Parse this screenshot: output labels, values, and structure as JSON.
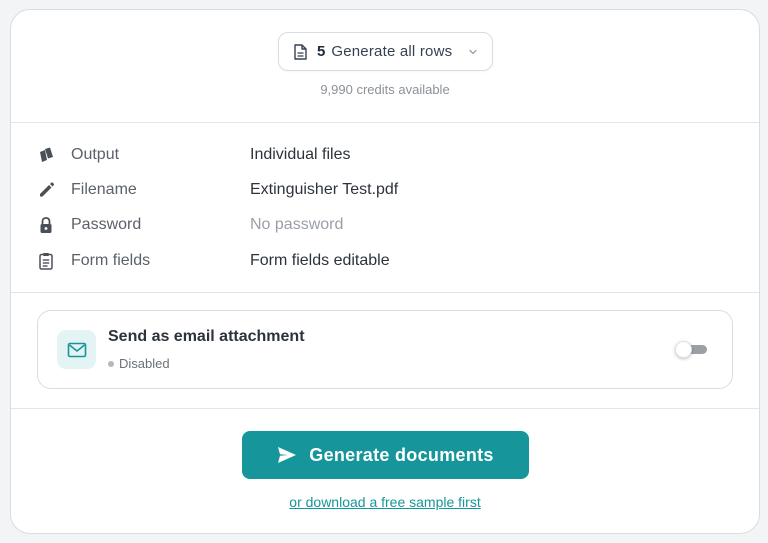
{
  "rows_selector": {
    "count": "5",
    "label": "Generate all rows",
    "credits": "9,990 credits available"
  },
  "settings": [
    {
      "icon": "output-icon",
      "key": "Output",
      "value": "Individual files",
      "muted": false
    },
    {
      "icon": "pencil-icon",
      "key": "Filename",
      "value": "Extinguisher Test.pdf",
      "muted": false
    },
    {
      "icon": "lock-icon",
      "key": "Password",
      "value": "No password",
      "muted": true
    },
    {
      "icon": "clipboard-icon",
      "key": "Form fields",
      "value": "Form fields editable",
      "muted": false
    }
  ],
  "email": {
    "title": "Send as email attachment",
    "status": "Disabled",
    "enabled": false
  },
  "actions": {
    "generate_label": "Generate documents",
    "sample_link": "or download a free sample first"
  },
  "colors": {
    "accent": "#16969a",
    "accent_light": "#e4f4f4"
  }
}
